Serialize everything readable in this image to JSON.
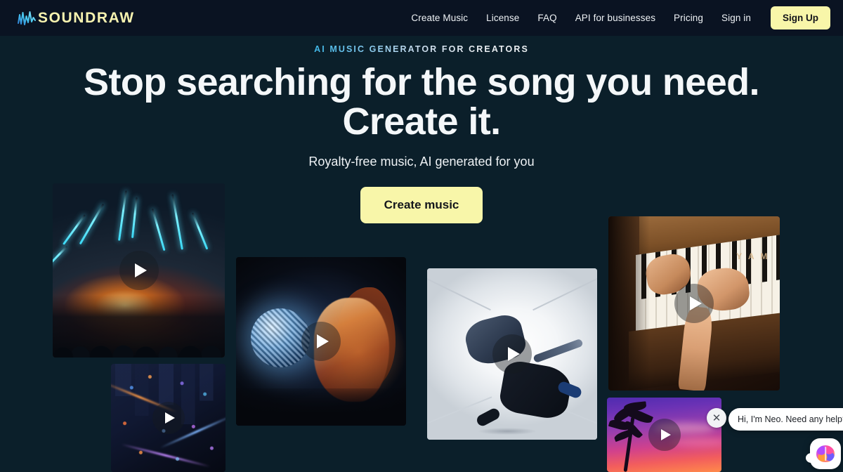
{
  "header": {
    "logo_icon": "soundwave-icon",
    "logo_text": "SOUNDRAW",
    "nav": [
      {
        "label": "Create Music"
      },
      {
        "label": "License"
      },
      {
        "label": "FAQ"
      },
      {
        "label": "API for businesses"
      },
      {
        "label": "Pricing"
      },
      {
        "label": "Sign in"
      }
    ],
    "signup_label": "Sign Up"
  },
  "hero": {
    "eyebrow": "AI MUSIC GENERATOR FOR CREATORS",
    "headline_line1": "Stop searching for the song you need.",
    "headline_line2": "Create it.",
    "subtitle": "Royalty-free music, AI generated for you",
    "cta_label": "Create music"
  },
  "media_cards": [
    {
      "name": "concert-lasers",
      "alt": "Concert with cyan laser beams over a crowd",
      "play_icon": "play-icon"
    },
    {
      "name": "disco-ball",
      "alt": "Woman holding a glowing disco ball",
      "play_icon": "play-icon"
    },
    {
      "name": "dancer-white-corridor",
      "alt": "Dancer mid-move in a bright white corridor",
      "play_icon": "play-icon"
    },
    {
      "name": "piano-hands",
      "alt": "Hands playing a wooden Yamaha piano",
      "play_icon": "play-icon"
    },
    {
      "name": "city-night",
      "alt": "Aerial night cityscape with neon lights",
      "play_icon": "play-icon"
    },
    {
      "name": "sunset-palms",
      "alt": "Palm tree silhouettes against a purple sunset",
      "play_icon": "play-icon"
    }
  ],
  "chat": {
    "message": "Hi, I'm Neo. Need any help?",
    "close_label": "✕",
    "avatar_icon": "brain-avatar-icon"
  },
  "colors": {
    "page_bg": "#0b1f2a",
    "header_bg": "#0a1322",
    "accent_yellow": "#f8f6a9",
    "text_primary": "#f4f7f9",
    "eyebrow_gradient_start": "#3fb8e8",
    "eyebrow_gradient_end": "#f2f6f8"
  }
}
